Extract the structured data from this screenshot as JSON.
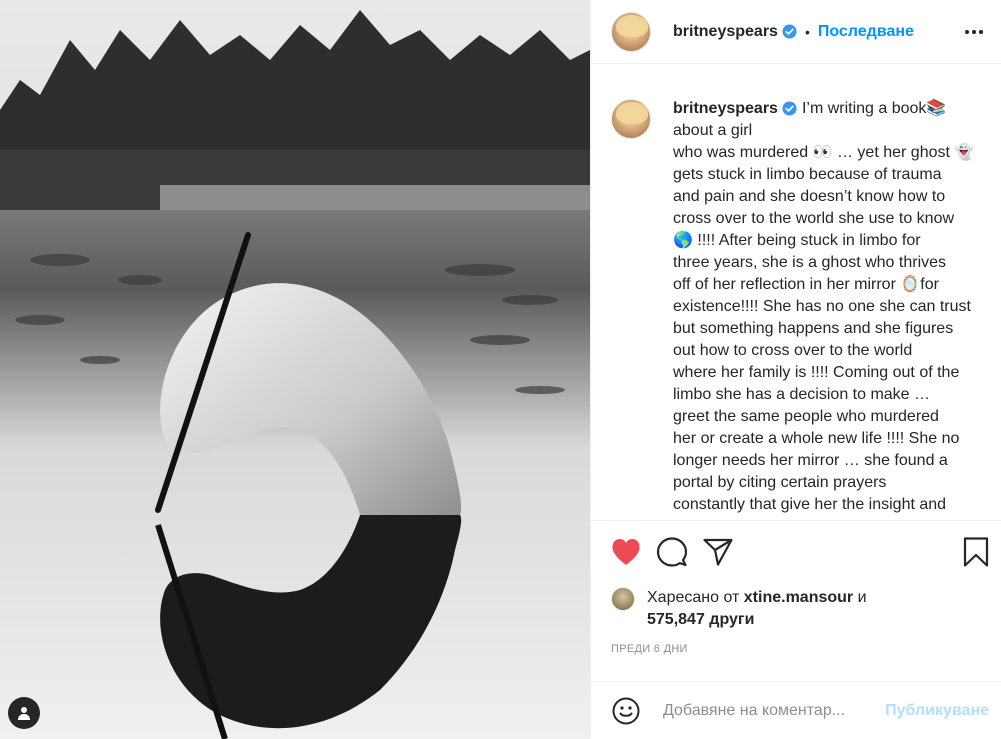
{
  "post": {
    "username": "britneyspears",
    "follow_label": "Последване",
    "separator": "•",
    "caption_lines": [
      "I’m writing a book📚",
      "about a girl",
      "who was murdered 👀 … yet her ghost 👻",
      "gets stuck in limbo because of trauma",
      "and pain and she doesn’t know how to",
      "cross over to the world she use to know",
      "🌎 !!!! After being stuck in limbo for",
      "three years, she is a ghost who thrives",
      "off of her reflection in her mirror 🪞for",
      "existence!!!! She has no one she can trust",
      "but something happens and she figures",
      "out how to cross over to the world",
      "where her family is !!!! Coming out of the",
      "limbo she has a decision to make …",
      "greet the same people who murdered",
      "her or create a whole new life !!!! She no",
      "longer needs her mirror … she found a",
      "portal by citing certain prayers",
      "constantly that give her the insight and"
    ]
  },
  "likes": {
    "prefix": "Харесано от",
    "liker": "xtine.mansour",
    "and": "и",
    "count": "575,847",
    "others": "други"
  },
  "timestamp": "Преди 6 дни",
  "comment": {
    "placeholder": "Добавяне на коментар...",
    "post_label": "Публикуване"
  },
  "colors": {
    "accent": "#0095f6",
    "like_red": "#ed4956",
    "post_disabled": "#b2dffc",
    "verified_blue": "#3897f0"
  },
  "icons": {
    "like": "heart-filled-icon",
    "comment": "comment-bubble-icon",
    "share": "paper-plane-icon",
    "save": "bookmark-icon",
    "more": "more-options-icon",
    "emoji": "smiley-icon",
    "tag": "user-tag-icon",
    "verified": "verified-badge-icon"
  }
}
